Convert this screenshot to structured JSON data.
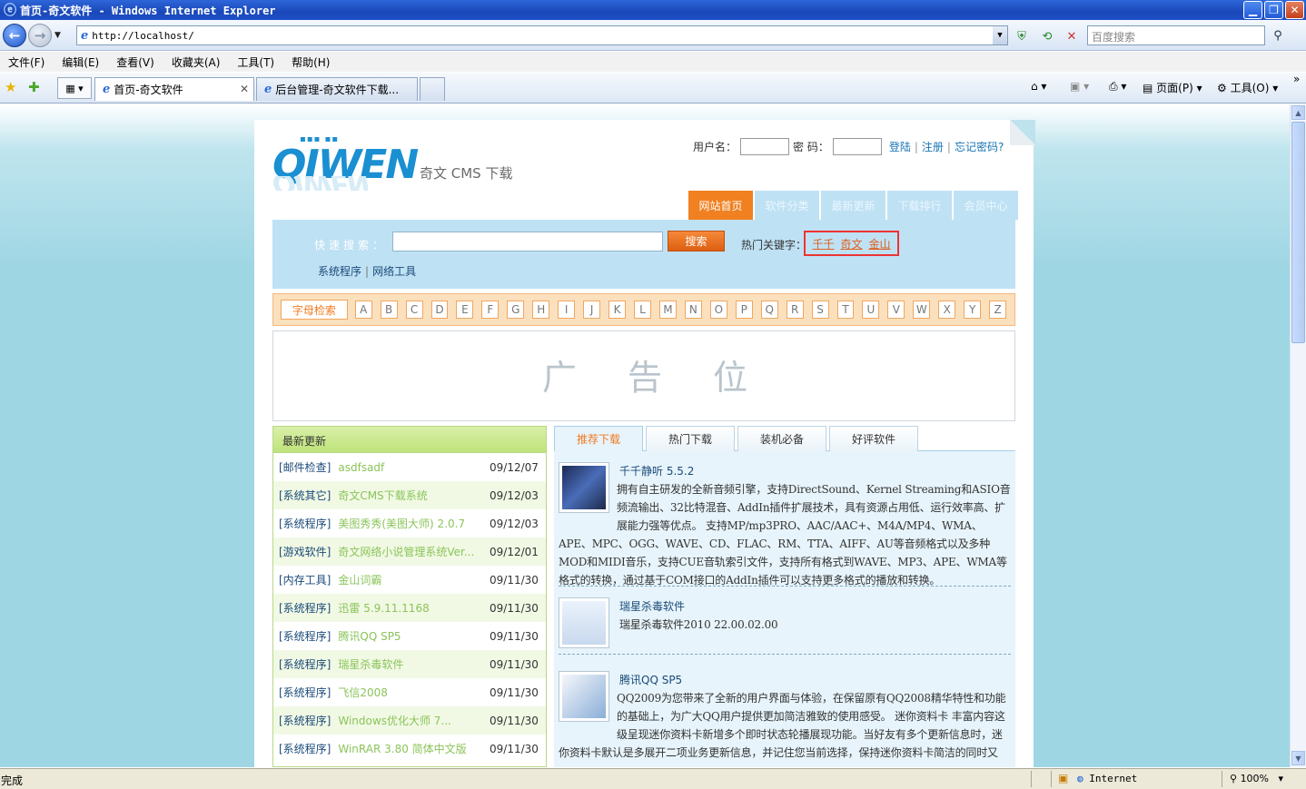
{
  "window": {
    "title": "首页-奇文软件 - Windows Internet Explorer"
  },
  "address": {
    "url": "http://localhost/",
    "search_placeholder": "百度搜索"
  },
  "menu": [
    "文件(F)",
    "编辑(E)",
    "查看(V)",
    "收藏夹(A)",
    "工具(T)",
    "帮助(H)"
  ],
  "tabs": [
    {
      "label": "首页-奇文软件"
    },
    {
      "label": "后台管理-奇文软件下载..."
    }
  ],
  "cmd": {
    "page": "页面(P)",
    "tools": "工具(O)"
  },
  "status": {
    "text": "完成",
    "zone": "Internet",
    "zoom": "100%"
  },
  "site": {
    "logo_text": "QIWEN",
    "logo_sub": "奇文 CMS 下载",
    "login": {
      "user_label": "用户名：",
      "pass_label": "密 码：",
      "login": "登陆",
      "register": "注册",
      "forgot": "忘记密码?"
    },
    "nav": [
      "网站首页",
      "软件分类",
      "最新更新",
      "下载排行",
      "会员中心"
    ],
    "search": {
      "label": "快速搜索：",
      "button": "搜索",
      "hot_label": "热门关键字：",
      "hot": [
        "千千",
        "奇文",
        "金山"
      ],
      "cats": [
        "系统程序",
        "网络工具"
      ]
    },
    "letters_label": "字母检索",
    "letters": [
      "A",
      "B",
      "C",
      "D",
      "E",
      "F",
      "G",
      "H",
      "I",
      "J",
      "K",
      "L",
      "M",
      "N",
      "O",
      "P",
      "Q",
      "R",
      "S",
      "T",
      "U",
      "V",
      "W",
      "X",
      "Y",
      "Z"
    ],
    "ad_text": "广告位",
    "latest": {
      "title": "最新更新",
      "items": [
        {
          "cat": "[邮件检查]",
          "title": "asdfsadf",
          "date": "09/12/07"
        },
        {
          "cat": "[系统其它]",
          "title": "奇文CMS下载系统",
          "date": "09/12/03"
        },
        {
          "cat": "[系统程序]",
          "title": "美图秀秀(美图大师) 2.0.7",
          "date": "09/12/03"
        },
        {
          "cat": "[游戏软件]",
          "title": "奇文网络小说管理系统Ver...",
          "date": "09/12/01"
        },
        {
          "cat": "[内存工具]",
          "title": "金山词霸",
          "date": "09/11/30"
        },
        {
          "cat": "[系统程序]",
          "title": "迅雷 5.9.11.1168",
          "date": "09/11/30"
        },
        {
          "cat": "[系统程序]",
          "title": "腾讯QQ SP5",
          "date": "09/11/30"
        },
        {
          "cat": "[系统程序]",
          "title": "瑞星杀毒软件",
          "date": "09/11/30"
        },
        {
          "cat": "[系统程序]",
          "title": "飞信2008",
          "date": "09/11/30"
        },
        {
          "cat": "[系统程序]",
          "title": "Windows优化大师 7...",
          "date": "09/11/30"
        },
        {
          "cat": "[系统程序]",
          "title": "WinRAR 3.80 简体中文版",
          "date": "09/11/30"
        }
      ]
    },
    "rec_tabs": [
      "推荐下载",
      "热门下载",
      "装机必备",
      "好评软件"
    ],
    "rec_items": [
      {
        "title": "千千静听 5.5.2",
        "desc": "拥有自主研发的全新音频引擎，支持DirectSound、Kernel Streaming和ASIO音频流输出、32比特混音、AddIn插件扩展技术，具有资源占用低、运行效率高、扩展能力强等优点。 支持MP/mp3PRO、AAC/AAC+、M4A/MP4、WMA、APE、MPC、OGG、WAVE、CD、FLAC、RM、TTA、AIFF、AU等音频格式以及多种MOD和MIDI音乐，支持CUE音轨索引文件，支持所有格式到WAVE、MP3、APE、WMA等格式的转换，通过基于COM接口的AddIn插件可以支持更多格式的播放和转换。"
      },
      {
        "title": "瑞星杀毒软件",
        "desc": "瑞星杀毒软件2010 22.00.02.00"
      },
      {
        "title": "腾讯QQ SP5",
        "desc": "QQ2009为您带来了全新的用户界面与体验，在保留原有QQ2008精华特性和功能的基础上，为广大QQ用户提供更加简洁雅致的使用感受。 迷你资料卡 丰富内容这级呈现迷你资料卡新增多个即时状态轮播展现功能。当好友有多个更新信息时，迷你资料卡默认是多展开二项业务更新信息，并记住您当前选择，保持迷你资料卡简洁的同时又"
      }
    ]
  }
}
